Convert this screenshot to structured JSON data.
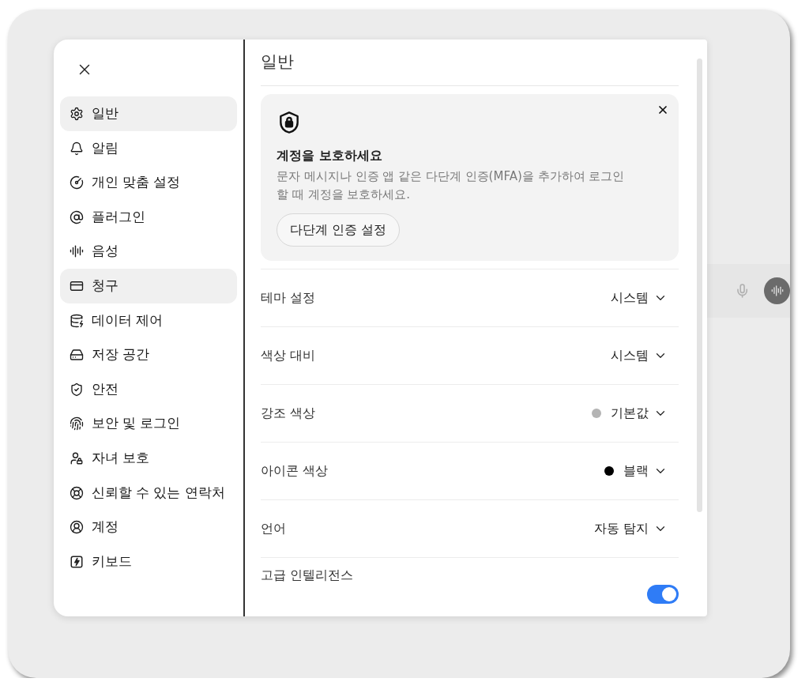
{
  "sidebar": {
    "items": [
      {
        "label": "일반",
        "selected": true
      },
      {
        "label": "알림",
        "selected": false
      },
      {
        "label": "개인 맞춤 설정",
        "selected": false
      },
      {
        "label": "플러그인",
        "selected": false
      },
      {
        "label": "음성",
        "selected": false
      },
      {
        "label": "청구",
        "selected": true
      },
      {
        "label": "데이터 제어",
        "selected": false
      },
      {
        "label": "저장 공간",
        "selected": false
      },
      {
        "label": "안전",
        "selected": false
      },
      {
        "label": "보안 및 로그인",
        "selected": false
      },
      {
        "label": "자녀 보호",
        "selected": false
      },
      {
        "label": "신뢰할 수 있는 연락처",
        "selected": false
      },
      {
        "label": "계정",
        "selected": false
      },
      {
        "label": "키보드",
        "selected": false
      }
    ]
  },
  "content": {
    "title": "일반",
    "notice": {
      "title": "계정을 보호하세요",
      "text": "문자 메시지나 인증 앱 같은 다단계 인증(MFA)을 추가하여 로그인할 때 계정을 보호하세요.",
      "button": "다단계 인증 설정"
    },
    "settings": [
      {
        "kind": "select",
        "label": "테마 설정",
        "value": "시스템"
      },
      {
        "kind": "select",
        "label": "색상 대비",
        "value": "시스템"
      },
      {
        "kind": "select",
        "label": "강조 색상",
        "value": "기본값",
        "color": "#b4b4b4"
      },
      {
        "kind": "select",
        "label": "아이콘 색상",
        "value": "블랙",
        "color": "#000000"
      },
      {
        "kind": "select",
        "label": "언어",
        "value": "자동 탐지"
      },
      {
        "kind": "toggle",
        "label": "고급 인텔리전스",
        "on": true
      }
    ]
  }
}
